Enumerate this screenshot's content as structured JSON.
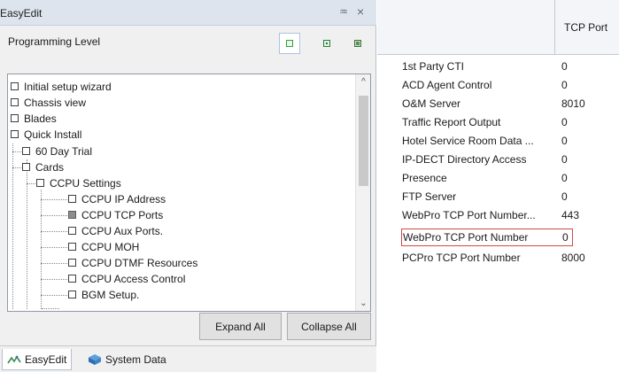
{
  "window": {
    "title": "EasyEdit",
    "pin_glyph": "♒",
    "close_glyph": "×"
  },
  "programming_level": {
    "label": "Programming Level",
    "buttons": [
      {
        "name": "basic-level-icon",
        "selected": true
      },
      {
        "name": "intermediate-level-icon",
        "selected": false
      },
      {
        "name": "advanced-level-icon",
        "selected": false
      }
    ]
  },
  "tree": {
    "items": [
      {
        "label": "Initial setup wizard",
        "depth": 0
      },
      {
        "label": "Chassis view",
        "depth": 0
      },
      {
        "label": "Blades",
        "depth": 0
      },
      {
        "label": "Quick Install",
        "depth": 0
      },
      {
        "label": "60 Day Trial",
        "depth": 1
      },
      {
        "label": "Cards",
        "depth": 1
      },
      {
        "label": "CCPU Settings",
        "depth": 2
      },
      {
        "label": "CCPU IP Address",
        "depth": 3
      },
      {
        "label": "CCPU TCP Ports",
        "depth": 3,
        "selected": true
      },
      {
        "label": "CCPU Aux Ports.",
        "depth": 3
      },
      {
        "label": "CCPU MOH",
        "depth": 3
      },
      {
        "label": "CCPU DTMF Resources",
        "depth": 3
      },
      {
        "label": "CCPU Access Control",
        "depth": 3
      },
      {
        "label": "BGM Setup.",
        "depth": 3
      }
    ]
  },
  "buttons": {
    "expand_all": "Expand All",
    "collapse_all": "Collapse All"
  },
  "tabs": [
    {
      "label": "EasyEdit",
      "icon": "easyedit-icon",
      "active": true
    },
    {
      "label": "System Data",
      "icon": "system-data-icon",
      "active": false
    }
  ],
  "grid": {
    "column_header": "TCP Port",
    "rows": [
      {
        "name": "1st Party CTI",
        "value": "0"
      },
      {
        "name": "ACD Agent Control",
        "value": "0"
      },
      {
        "name": "O&M Server",
        "value": "8010"
      },
      {
        "name": "Traffic Report Output",
        "value": "0"
      },
      {
        "name": "Hotel Service Room Data ...",
        "value": "0"
      },
      {
        "name": "IP-DECT Directory Access",
        "value": "0"
      },
      {
        "name": "Presence",
        "value": "0"
      },
      {
        "name": "FTP Server",
        "value": "0"
      },
      {
        "name": "WebPro TCP Port Number...",
        "value": "443"
      },
      {
        "name": "WebPro TCP Port Number",
        "value": "0",
        "highlighted": true
      },
      {
        "name": "PCPro TCP Port Number",
        "value": "8000"
      }
    ]
  },
  "colors": {
    "highlight_border": "#d04a4a",
    "title_bar": "#dde4ee"
  }
}
